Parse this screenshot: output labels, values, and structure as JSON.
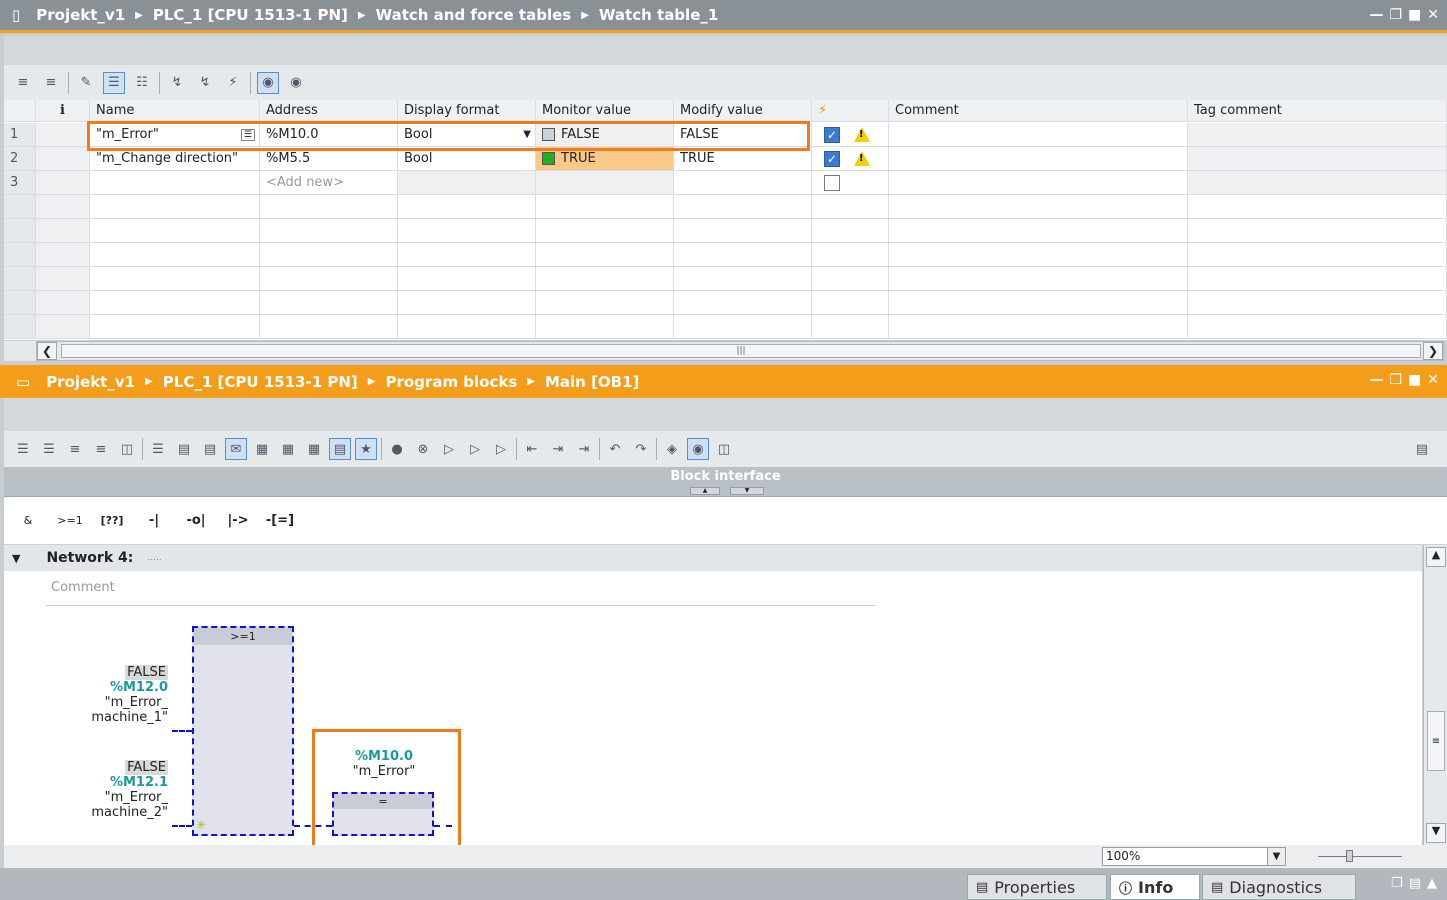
{
  "watch_window": {
    "breadcrumb": [
      "Projekt_v1",
      "PLC_1 [CPU 1513-1 PN]",
      "Watch and force tables",
      "Watch table_1"
    ],
    "columns": [
      "",
      "Name",
      "Address",
      "Display format",
      "Monitor value",
      "Modify value",
      "",
      "Comment",
      "Tag comment"
    ],
    "rows": [
      {
        "num": "1",
        "name": "\"m_Error\"",
        "address": "%M10.0",
        "format": "Bool",
        "monitor": "FALSE",
        "modify": "FALSE"
      },
      {
        "num": "2",
        "name": "\"m_Change direction\"",
        "address": "%M5.5",
        "format": "Bool",
        "monitor": "TRUE",
        "modify": "TRUE"
      },
      {
        "num": "3",
        "name": "",
        "address": "<Add new>",
        "format": "",
        "monitor": "",
        "modify": ""
      }
    ]
  },
  "program_window": {
    "breadcrumb": [
      "Projekt_v1",
      "PLC_1 [CPU 1513-1 PN]",
      "Program blocks",
      "Main [OB1]"
    ],
    "block_interface": "Block interface",
    "lad_buttons": [
      "&",
      ">=1",
      "[??]",
      "-|",
      "-o|",
      "|->",
      "-[=]"
    ],
    "network": {
      "title": "Network 4:",
      "dots": ".....",
      "comment_placeholder": "Comment"
    },
    "or_box": {
      "label": ">=1"
    },
    "inputs": [
      {
        "state": "FALSE",
        "address": "%M12.0",
        "tag1": "\"m_Error_",
        "tag2": "machine_1\""
      },
      {
        "state": "FALSE",
        "address": "%M12.1",
        "tag1": "\"m_Error_",
        "tag2": "machine_2\""
      }
    ],
    "output": {
      "address": "%M10.0",
      "tag": "\"m_Error\"",
      "label": "="
    },
    "zoom": "100%"
  },
  "bottom_tabs": [
    "Properties",
    "Info",
    "Diagnostics"
  ],
  "colors": {
    "accent": "#f49d1a",
    "highlight": "#f07b1a",
    "address": "#1a9a9a",
    "wire": "#1010d0"
  }
}
